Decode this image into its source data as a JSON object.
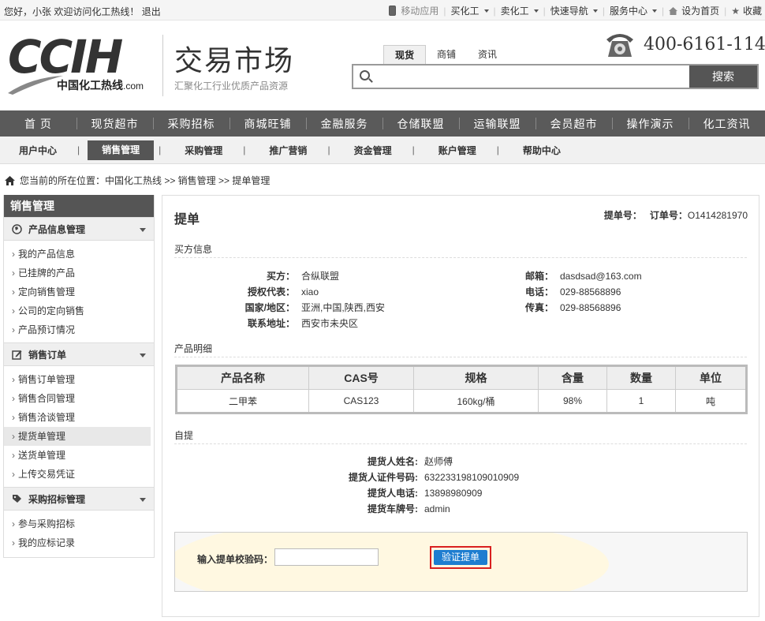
{
  "topbar": {
    "greeting_prefix": "您好，小张 欢迎访问化工热线！",
    "logout": "退出",
    "mobile_app": "移动应用",
    "buy_chem": "买化工",
    "sell_chem": "卖化工",
    "quick_nav": "快速导航",
    "service_center": "服务中心",
    "set_home": "设为首页",
    "favorite": "收藏"
  },
  "header": {
    "logo_main": "CCIH",
    "logo_cn": "中国化工热线",
    "logo_domain": ".com",
    "market_title": "交易市场",
    "market_subtitle": "汇聚化工行业优质产品资源",
    "search_tabs": [
      "现货",
      "商铺",
      "资讯"
    ],
    "search_active_tab": "现货",
    "search_placeholder": "",
    "search_button": "搜索",
    "hotline": "400-6161-114"
  },
  "mainnav": [
    "首 页",
    "现货超市",
    "采购招标",
    "商城旺铺",
    "金融服务",
    "仓储联盟",
    "运输联盟",
    "会员超市",
    "操作演示",
    "化工资讯"
  ],
  "subnav": {
    "items": [
      "用户中心",
      "销售管理",
      "采购管理",
      "推广营销",
      "资金管理",
      "账户管理",
      "帮助中心"
    ],
    "active": "销售管理"
  },
  "breadcrumb": "您当前的所在位置：中国化工热线 >> 销售管理 >> 提单管理",
  "sidebar": {
    "title": "销售管理",
    "groups": [
      {
        "label": "产品信息管理",
        "icon": "globe-icon",
        "items": [
          "我的产品信息",
          "已挂牌的产品",
          "定向销售管理",
          "公司的定向销售",
          "产品预订情况"
        ]
      },
      {
        "label": "销售订单",
        "icon": "edit-icon",
        "items": [
          "销售订单管理",
          "销售合同管理",
          "销售洽谈管理",
          "提货单管理",
          "送货单管理",
          "上传交易凭证"
        ]
      },
      {
        "label": "采购招标管理",
        "icon": "tag-icon",
        "items": [
          "参与采购招标",
          "我的应标记录"
        ]
      }
    ],
    "selected_item": "提货单管理"
  },
  "content": {
    "title": "提单",
    "bill_no_label": "提单号：",
    "bill_no": "",
    "order_no_label": "订单号：",
    "order_no": "O1414281970",
    "buyer_section": "买方信息",
    "buyer_left": [
      {
        "k": "买方：",
        "v": "合纵联盟"
      },
      {
        "k": "授权代表：",
        "v": "xiao"
      },
      {
        "k": "国家/地区：",
        "v": "亚洲,中国,陕西,西安"
      },
      {
        "k": "联系地址：",
        "v": "西安市未央区"
      }
    ],
    "buyer_right": [
      {
        "k": "邮箱：",
        "v": "dasdsad@163.com"
      },
      {
        "k": "电话：",
        "v": "029-88568896"
      },
      {
        "k": "传真：",
        "v": "029-88568896"
      }
    ],
    "product_section": "产品明细",
    "table_headers": [
      "产品名称",
      "CAS号",
      "规格",
      "含量",
      "数量",
      "单位"
    ],
    "table_rows": [
      [
        "二甲苯",
        "CAS123",
        "160kg/桶",
        "98%",
        "1",
        "吨"
      ]
    ],
    "pickup_section": "自提",
    "pickup": [
      {
        "k": "提货人姓名:",
        "v": "赵师傅"
      },
      {
        "k": "提货人证件号码:",
        "v": "632233198109010909"
      },
      {
        "k": "提货人电话:",
        "v": "13898980909"
      },
      {
        "k": "提货车牌号:",
        "v": "admin"
      }
    ],
    "verify_label": "输入提单校验码：",
    "verify_value": "",
    "verify_button": "验证提单"
  }
}
